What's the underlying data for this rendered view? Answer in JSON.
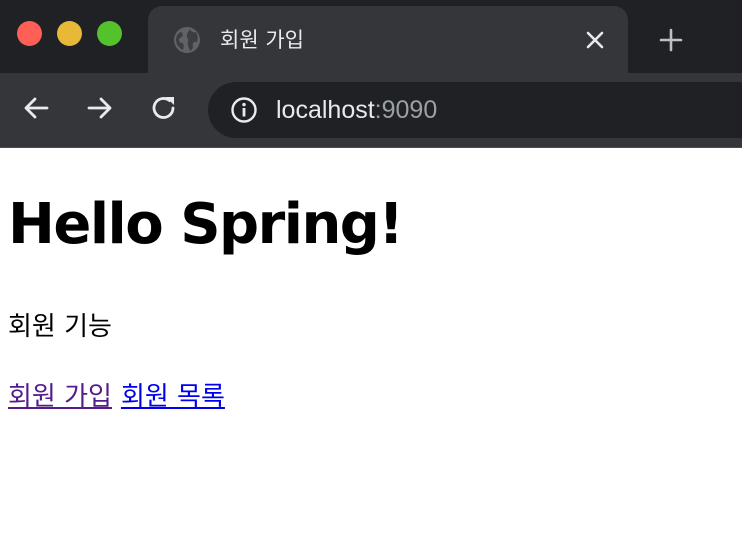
{
  "browser": {
    "tab": {
      "title": "회원 가입"
    },
    "address_bar": {
      "host": "localhost",
      "port": ":9090"
    }
  },
  "page": {
    "heading": "Hello Spring!",
    "section_label": "회원 기능",
    "links": [
      {
        "label": "회원 가입",
        "state": "visited"
      },
      {
        "label": "회원 목록",
        "state": "unvisited"
      }
    ]
  },
  "colors": {
    "visited_link": "#551a8b",
    "unvisited_link": "#0000ee",
    "chrome_dark": "#202124",
    "chrome_tab": "#35363a"
  }
}
